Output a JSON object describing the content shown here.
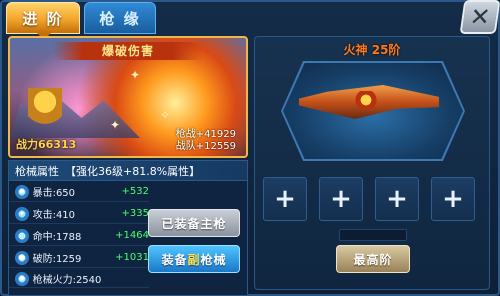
{
  "tabs": [
    {
      "label": "进 阶",
      "active": true
    },
    {
      "label": "枪 缘",
      "active": false
    }
  ],
  "close_icon": "close-icon",
  "hero": {
    "banner": "爆破伤害",
    "power_label": "战力66313",
    "stat_lines": [
      "枪战+41929",
      "战队+12559"
    ]
  },
  "attributes": {
    "header": "枪械属性",
    "subheader": "【强化36级+81.8%属性】",
    "rows": [
      {
        "icon": "crit-icon",
        "name": "暴击:650",
        "bonus": "+532"
      },
      {
        "icon": "attack-icon",
        "name": "攻击:410",
        "bonus": "+335"
      },
      {
        "icon": "hit-icon",
        "name": "命中:1788",
        "bonus": "+1464"
      },
      {
        "icon": "pierce-icon",
        "name": "破防:1259",
        "bonus": "+1031"
      },
      {
        "icon": "firepower-icon",
        "name": "枪械火力:2540",
        "bonus": ""
      }
    ]
  },
  "buttons": {
    "equipped_main": "已装备主枪",
    "equip_sub_prefix": "装备",
    "equip_sub_highlight": "副",
    "equip_sub_suffix": "枪械",
    "max_level": "最高阶"
  },
  "weapon": {
    "title": "火神 25阶"
  },
  "slots": [
    "+",
    "+",
    "+",
    "+"
  ],
  "colors": {
    "tab_active": "#f2a52a",
    "tab_idle": "#1a5d9e",
    "bonus_green": "#4cff6a",
    "weapon_title": "#ff7a1a"
  }
}
